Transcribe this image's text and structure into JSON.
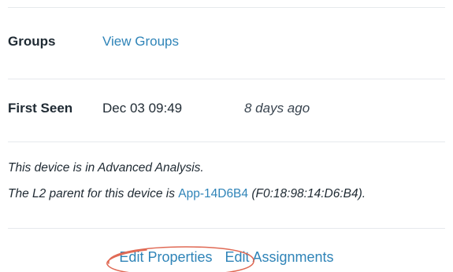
{
  "groups": {
    "label": "Groups",
    "link": "View Groups"
  },
  "first_seen": {
    "label": "First Seen",
    "date": "Dec 03 09:49",
    "relative": "8 days ago"
  },
  "analysis_note": {
    "line1": "This device is in Advanced Analysis.",
    "line2_prefix": "The L2 parent for this device is ",
    "parent_link": "App-14D6B4",
    "line2_suffix": " (F0:18:98:14:D6:B4)."
  },
  "actions": {
    "edit_properties": "Edit Properties",
    "edit_assignments": "Edit Assignments"
  },
  "colors": {
    "link": "#2f84b8",
    "highlight_circle": "#e06a55"
  }
}
